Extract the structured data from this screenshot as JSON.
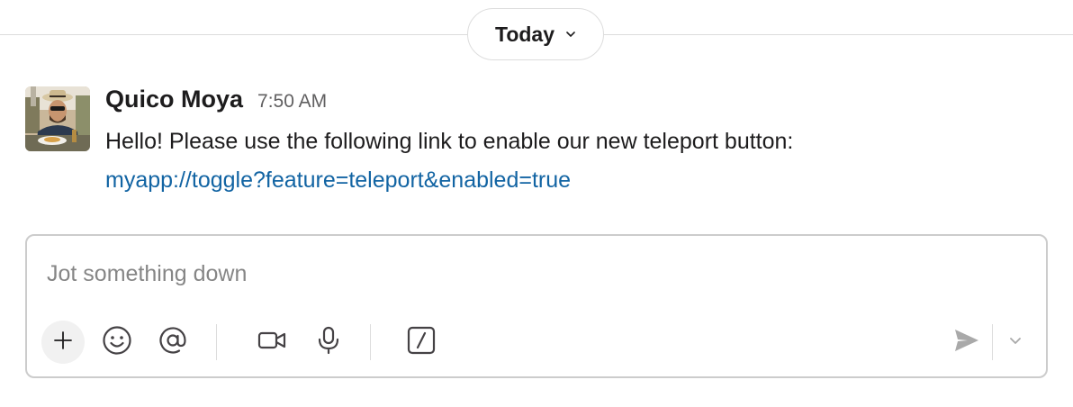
{
  "divider": {
    "date_label": "Today"
  },
  "message": {
    "sender": "Quico Moya",
    "time": "7:50 AM",
    "text": "Hello! Please use the following link to enable our new teleport button:",
    "link": "myapp://toggle?feature=teleport&enabled=true"
  },
  "composer": {
    "placeholder": "Jot something down",
    "value": "",
    "toolbar_icons": [
      "plus-icon",
      "emoji-icon",
      "mention-icon",
      "video-icon",
      "microphone-icon",
      "slash-command-icon",
      "send-icon",
      "chevron-down-icon"
    ]
  },
  "colors": {
    "link": "#1264a3",
    "text": "#1d1c1d",
    "muted": "#616061",
    "border": "#cccccc",
    "divider": "#dddddd"
  }
}
